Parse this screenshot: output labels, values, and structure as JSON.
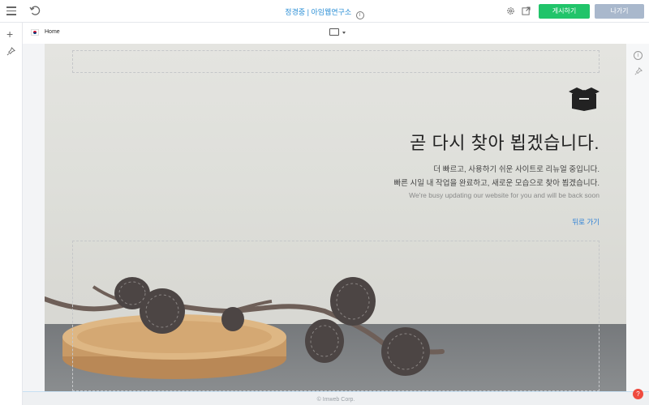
{
  "topbar": {
    "title": "정경중 | 아임웹연구소",
    "publish_label": "게시하기",
    "exit_label": "나가기",
    "icons": [
      "menu-icon",
      "undo-icon",
      "info-icon",
      "gear-icon",
      "external-link-icon"
    ],
    "colors": {
      "publish": "#21c46a",
      "exit": "#a9b8cc",
      "title": "#2b8fd6"
    }
  },
  "subbar": {
    "page_name": "Home",
    "icons": [
      "korea-flag-icon",
      "desktop-icon",
      "chevron-down-icon"
    ]
  },
  "leftbar": {
    "icons": [
      "plus-icon",
      "pin-icon"
    ]
  },
  "rightbar": {
    "icons": [
      "info-icon",
      "pin-icon"
    ]
  },
  "page": {
    "heading": "곧 다시 찾아 뵙겠습니다.",
    "line1": "더 빠르고, 사용하기 쉬운 사이트로 리뉴얼 중입니다.",
    "line2": "빠른 시일 내 작업을 완료하고, 새로운 모습으로 찾아 뵙겠습니다.",
    "line3": "We're busy updating our website for you and will be back soon",
    "back_link": "뒤로 가기",
    "colors": {
      "link": "#2b7fd6"
    }
  },
  "footer": {
    "copyright": "© Imweb Corp."
  },
  "help": {
    "label": "?"
  }
}
